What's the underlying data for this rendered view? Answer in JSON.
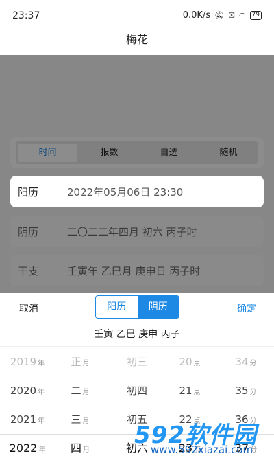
{
  "status_bar": {
    "time": "23:37",
    "speed": "0.0K/s",
    "battery": "79"
  },
  "title": "梅花",
  "mode_tabs": [
    "时间",
    "报数",
    "自选",
    "随机"
  ],
  "rows": [
    {
      "label": "阳历",
      "value": "2022年05月06日 23:30"
    },
    {
      "label": "阴历",
      "value": "二〇二二年四月 初六 丙子时"
    },
    {
      "label": "干支",
      "value": "壬寅年 乙巳月 庚申日 丙子时"
    }
  ],
  "sheet": {
    "cancel": "取消",
    "confirm": "确定",
    "toggle": [
      "阳历",
      "阴历"
    ],
    "ganzhi": "壬寅 乙巳 庚申 丙子"
  },
  "picker": {
    "years": [
      "2019",
      "2020",
      "2021",
      "2022"
    ],
    "year_unit": "年",
    "months": [
      "正",
      "二",
      "三",
      "四"
    ],
    "month_unit": "月",
    "days": [
      "初三",
      "初四",
      "初五",
      "初六"
    ],
    "hours": [
      "20",
      "21",
      "22",
      "23"
    ],
    "hour_unit": "点",
    "minutes": [
      "34",
      "35",
      "36",
      "37"
    ],
    "minute_unit": "分"
  },
  "watermark": {
    "brand": "592软件园",
    "url": "www.592xiazai.com"
  },
  "colors": {
    "accent": "#1e88e5",
    "overlay": "rgba(0,0,0,0.45)"
  },
  "icons": [
    "mute-icon",
    "sim-icon",
    "wifi-icon",
    "battery-icon"
  ]
}
